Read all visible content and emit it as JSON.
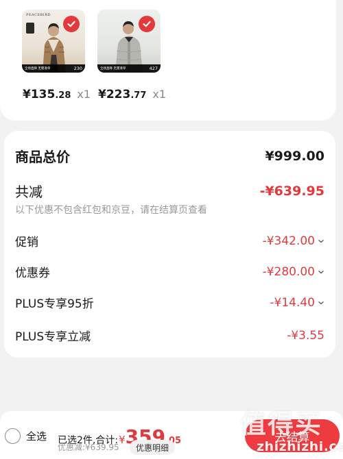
{
  "products": [
    {
      "brand": "PEACEBIRD",
      "tag": "全场直降 无需凑单",
      "badge_num": "230",
      "price_yen": "¥",
      "price_int": "135",
      "price_dec": ".28",
      "qty": "x1"
    },
    {
      "brand": "",
      "tag": "全场直降 无需凑单",
      "badge_num": "427",
      "price_yen": "¥",
      "price_int": "223",
      "price_dec": ".77",
      "qty": "x1"
    }
  ],
  "summary": {
    "total_label": "商品总价",
    "total_value": "¥999.00",
    "discount_label": "共减",
    "discount_value": "-¥639.95",
    "note": "以下优惠不包含红包和京豆，请在结算页查看",
    "items": [
      {
        "label": "促销",
        "value": "-¥342.00",
        "has_chevron": true
      },
      {
        "label": "优惠券",
        "value": "-¥280.00",
        "has_chevron": true
      },
      {
        "label": "PLUS专享95折",
        "value": "-¥14.40",
        "has_chevron": true
      },
      {
        "label": "PLUS专享立减",
        "value": "-¥3.55",
        "has_chevron": false
      }
    ]
  },
  "bottom": {
    "select_all": "全选",
    "selected_text": "已选2件,合计:",
    "total_yen": "¥",
    "total_int": "359",
    "total_dec": ".05",
    "discount_line": "优惠减:¥639.95",
    "detail_button": "优惠明细",
    "checkout_button": "去结算"
  },
  "watermark": {
    "logo": "值得买",
    "url": "zhizhizhi.com"
  },
  "colors": {
    "accent_red": "#e4393c",
    "checkout_red": "#ee3b3f",
    "muted_text": "#999999"
  },
  "icons": [
    "check-icon",
    "chevron-down-icon",
    "radio-unchecked-icon"
  ]
}
